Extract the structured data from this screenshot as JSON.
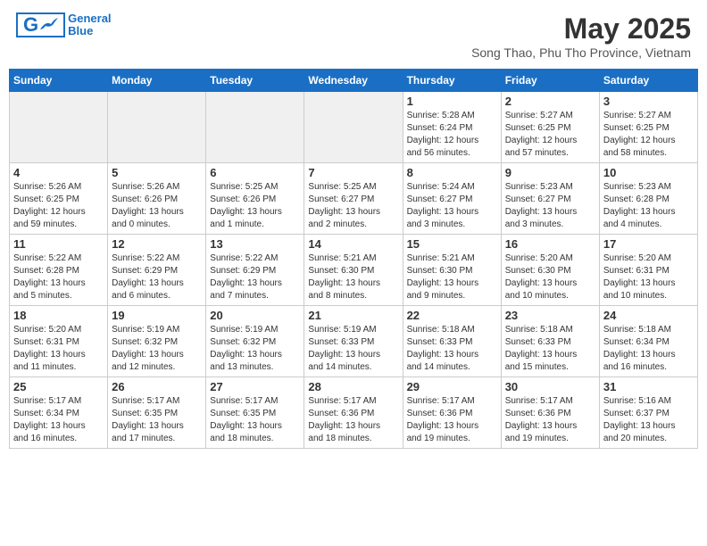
{
  "header": {
    "logo_general": "General",
    "logo_blue": "Blue",
    "month_title": "May 2025",
    "location": "Song Thao, Phu Tho Province, Vietnam"
  },
  "days_of_week": [
    "Sunday",
    "Monday",
    "Tuesday",
    "Wednesday",
    "Thursday",
    "Friday",
    "Saturday"
  ],
  "weeks": [
    [
      {
        "day": "",
        "info": "",
        "shaded": true
      },
      {
        "day": "",
        "info": "",
        "shaded": true
      },
      {
        "day": "",
        "info": "",
        "shaded": true
      },
      {
        "day": "",
        "info": "",
        "shaded": true
      },
      {
        "day": "1",
        "info": "Sunrise: 5:28 AM\nSunset: 6:24 PM\nDaylight: 12 hours\nand 56 minutes."
      },
      {
        "day": "2",
        "info": "Sunrise: 5:27 AM\nSunset: 6:25 PM\nDaylight: 12 hours\nand 57 minutes."
      },
      {
        "day": "3",
        "info": "Sunrise: 5:27 AM\nSunset: 6:25 PM\nDaylight: 12 hours\nand 58 minutes."
      }
    ],
    [
      {
        "day": "4",
        "info": "Sunrise: 5:26 AM\nSunset: 6:25 PM\nDaylight: 12 hours\nand 59 minutes."
      },
      {
        "day": "5",
        "info": "Sunrise: 5:26 AM\nSunset: 6:26 PM\nDaylight: 13 hours\nand 0 minutes."
      },
      {
        "day": "6",
        "info": "Sunrise: 5:25 AM\nSunset: 6:26 PM\nDaylight: 13 hours\nand 1 minute."
      },
      {
        "day": "7",
        "info": "Sunrise: 5:25 AM\nSunset: 6:27 PM\nDaylight: 13 hours\nand 2 minutes."
      },
      {
        "day": "8",
        "info": "Sunrise: 5:24 AM\nSunset: 6:27 PM\nDaylight: 13 hours\nand 3 minutes."
      },
      {
        "day": "9",
        "info": "Sunrise: 5:23 AM\nSunset: 6:27 PM\nDaylight: 13 hours\nand 3 minutes."
      },
      {
        "day": "10",
        "info": "Sunrise: 5:23 AM\nSunset: 6:28 PM\nDaylight: 13 hours\nand 4 minutes."
      }
    ],
    [
      {
        "day": "11",
        "info": "Sunrise: 5:22 AM\nSunset: 6:28 PM\nDaylight: 13 hours\nand 5 minutes."
      },
      {
        "day": "12",
        "info": "Sunrise: 5:22 AM\nSunset: 6:29 PM\nDaylight: 13 hours\nand 6 minutes."
      },
      {
        "day": "13",
        "info": "Sunrise: 5:22 AM\nSunset: 6:29 PM\nDaylight: 13 hours\nand 7 minutes."
      },
      {
        "day": "14",
        "info": "Sunrise: 5:21 AM\nSunset: 6:30 PM\nDaylight: 13 hours\nand 8 minutes."
      },
      {
        "day": "15",
        "info": "Sunrise: 5:21 AM\nSunset: 6:30 PM\nDaylight: 13 hours\nand 9 minutes."
      },
      {
        "day": "16",
        "info": "Sunrise: 5:20 AM\nSunset: 6:30 PM\nDaylight: 13 hours\nand 10 minutes."
      },
      {
        "day": "17",
        "info": "Sunrise: 5:20 AM\nSunset: 6:31 PM\nDaylight: 13 hours\nand 10 minutes."
      }
    ],
    [
      {
        "day": "18",
        "info": "Sunrise: 5:20 AM\nSunset: 6:31 PM\nDaylight: 13 hours\nand 11 minutes."
      },
      {
        "day": "19",
        "info": "Sunrise: 5:19 AM\nSunset: 6:32 PM\nDaylight: 13 hours\nand 12 minutes."
      },
      {
        "day": "20",
        "info": "Sunrise: 5:19 AM\nSunset: 6:32 PM\nDaylight: 13 hours\nand 13 minutes."
      },
      {
        "day": "21",
        "info": "Sunrise: 5:19 AM\nSunset: 6:33 PM\nDaylight: 13 hours\nand 14 minutes."
      },
      {
        "day": "22",
        "info": "Sunrise: 5:18 AM\nSunset: 6:33 PM\nDaylight: 13 hours\nand 14 minutes."
      },
      {
        "day": "23",
        "info": "Sunrise: 5:18 AM\nSunset: 6:33 PM\nDaylight: 13 hours\nand 15 minutes."
      },
      {
        "day": "24",
        "info": "Sunrise: 5:18 AM\nSunset: 6:34 PM\nDaylight: 13 hours\nand 16 minutes."
      }
    ],
    [
      {
        "day": "25",
        "info": "Sunrise: 5:17 AM\nSunset: 6:34 PM\nDaylight: 13 hours\nand 16 minutes."
      },
      {
        "day": "26",
        "info": "Sunrise: 5:17 AM\nSunset: 6:35 PM\nDaylight: 13 hours\nand 17 minutes."
      },
      {
        "day": "27",
        "info": "Sunrise: 5:17 AM\nSunset: 6:35 PM\nDaylight: 13 hours\nand 18 minutes."
      },
      {
        "day": "28",
        "info": "Sunrise: 5:17 AM\nSunset: 6:36 PM\nDaylight: 13 hours\nand 18 minutes."
      },
      {
        "day": "29",
        "info": "Sunrise: 5:17 AM\nSunset: 6:36 PM\nDaylight: 13 hours\nand 19 minutes."
      },
      {
        "day": "30",
        "info": "Sunrise: 5:17 AM\nSunset: 6:36 PM\nDaylight: 13 hours\nand 19 minutes."
      },
      {
        "day": "31",
        "info": "Sunrise: 5:16 AM\nSunset: 6:37 PM\nDaylight: 13 hours\nand 20 minutes."
      }
    ]
  ]
}
